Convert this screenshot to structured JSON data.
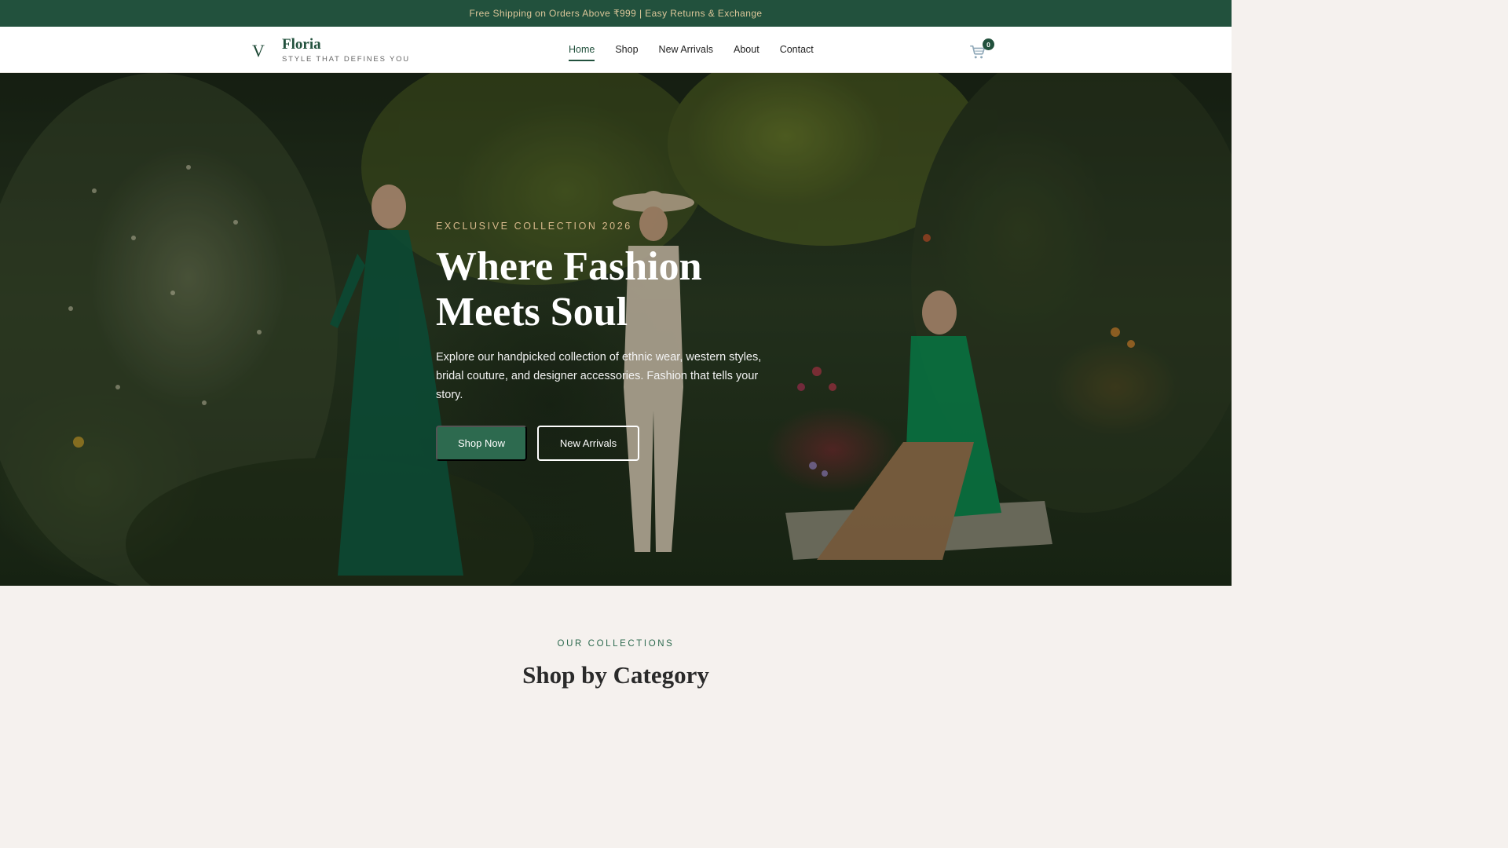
{
  "announcement": "Free Shipping on Orders Above ₹999 | Easy Returns & Exchange",
  "brand": {
    "mark": "V",
    "name": "Floria",
    "tagline": "STYLE THAT DEFINES YOU"
  },
  "nav": {
    "items": [
      {
        "label": "Home",
        "active": true
      },
      {
        "label": "Shop",
        "active": false
      },
      {
        "label": "New Arrivals",
        "active": false
      },
      {
        "label": "About",
        "active": false
      },
      {
        "label": "Contact",
        "active": false
      }
    ]
  },
  "cart": {
    "icon": "cart-icon",
    "count": "0"
  },
  "hero": {
    "eyebrow": "EXCLUSIVE COLLECTION 2026",
    "headline_line1": "Where Fashion",
    "headline_line2": "Meets Soul",
    "description": "Explore our handpicked collection of ethnic wear, western styles, bridal couture, and designer accessories. Fashion that tells your story.",
    "primary_cta": "Shop Now",
    "secondary_cta": "New Arrivals"
  },
  "collections": {
    "eyebrow": "OUR COLLECTIONS",
    "title": "Shop by Category"
  },
  "colors": {
    "brand_green": "#22513d",
    "button_green": "#2d6a4f",
    "gold_accent": "#d8b98c",
    "section_bg": "#f5f1ee"
  }
}
